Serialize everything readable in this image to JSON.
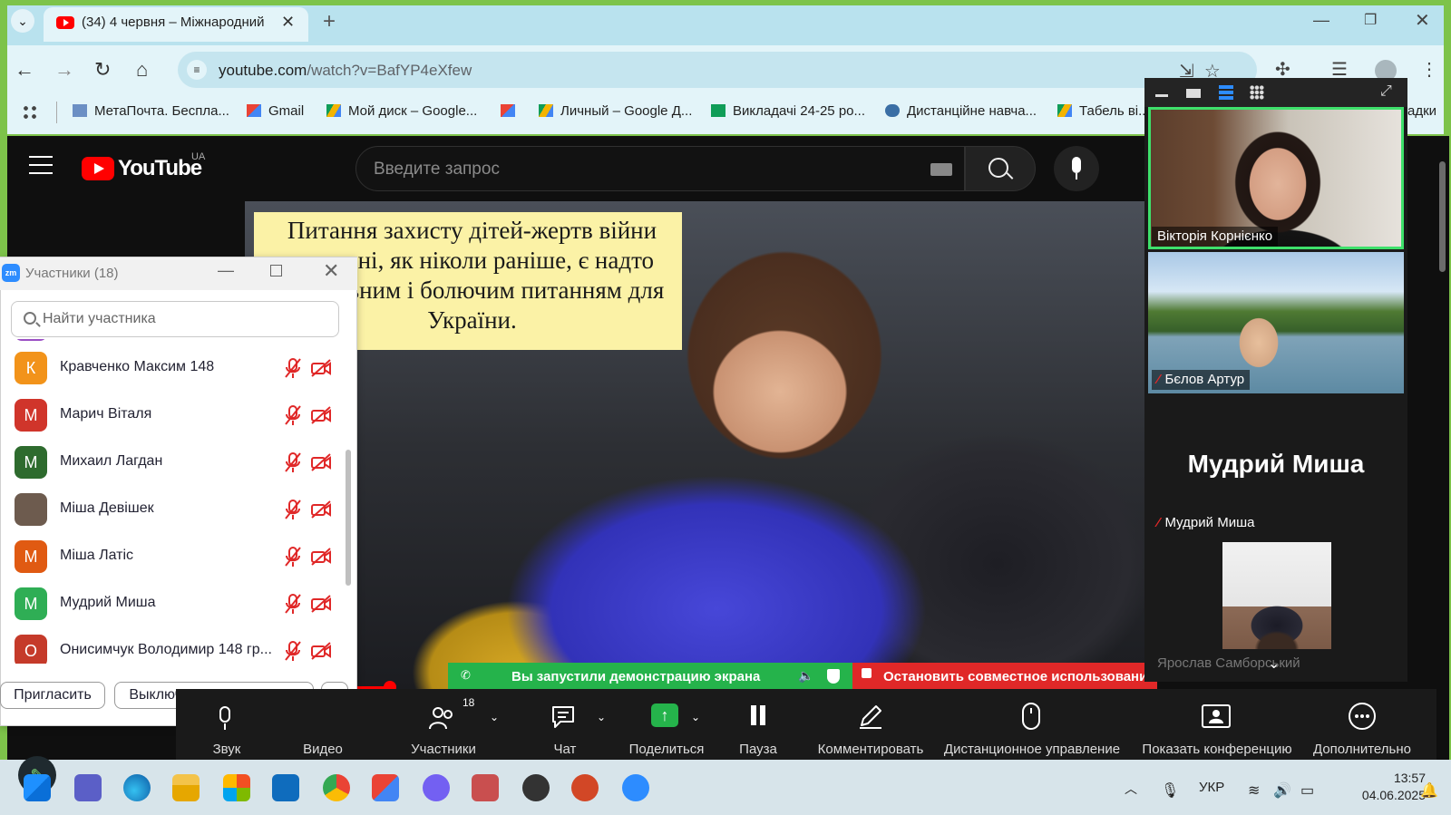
{
  "browser": {
    "tab_title": "(34) 4 червня – Міжнародний",
    "url_host": "youtube.com",
    "url_path": "/watch?v=BafYP4eXfew",
    "bookmarks": [
      {
        "label": "МетаПочта. Беспла..."
      },
      {
        "label": "Gmail"
      },
      {
        "label": "Мой диск – Google..."
      },
      {
        "label": ""
      },
      {
        "label": "Личный – Google Д..."
      },
      {
        "label": "Викладачі 24-25 ро..."
      },
      {
        "label": "Дистанційне навча..."
      },
      {
        "label": "Табель ві..."
      },
      {
        "label": "адки"
      }
    ]
  },
  "youtube": {
    "logo_text": "YouTube",
    "region": "UA",
    "search_placeholder": "Введите запрос",
    "caption": "Питання захисту дітей-жертв війни сьогодні, як ніколи раніше, є надто актуальним і болючим питанням для України.",
    "progress_fraction": 0.16
  },
  "zoom_participants": {
    "title": "Участники (18)",
    "search_placeholder": "Найти участника",
    "participants": [
      {
        "initial": "К",
        "name": "Кравченко Максим 148",
        "color": "#f2931a"
      },
      {
        "initial": "М",
        "name": "Марич Віталя",
        "color": "#d0352b"
      },
      {
        "initial": "М",
        "name": "Михаил Лагдан",
        "color": "#2e6b2e"
      },
      {
        "initial": "",
        "name": "Міша Девішек",
        "color": "#6d5b4e"
      },
      {
        "initial": "М",
        "name": "Міша Латіс",
        "color": "#e05a12"
      },
      {
        "initial": "М",
        "name": "Мудрий Миша",
        "color": "#2fae55"
      },
      {
        "initial": "О",
        "name": "Онисимчук Володимир 148 гр...",
        "color": "#c53a2a"
      }
    ],
    "invite_label": "Пригласить",
    "mute_all_label": "Выключить звук для всех",
    "more_label": "···"
  },
  "zoom_share": {
    "sharing_text": "Вы запустили демонстрацию экрана",
    "stop_text": "Остановить совместное использование"
  },
  "zoom_toolbar": {
    "participants_count": "18",
    "items": [
      {
        "label": "Звук"
      },
      {
        "label": "Видео"
      },
      {
        "label": "Участники"
      },
      {
        "label": "Чат"
      },
      {
        "label": "Поделиться"
      },
      {
        "label": "Пауза"
      },
      {
        "label": "Комментировать"
      },
      {
        "label": "Дистанционное управление"
      },
      {
        "label": "Показать конференцию"
      },
      {
        "label": "Дополнительно"
      }
    ]
  },
  "zoom_gallery": {
    "tiles": [
      {
        "name": "Вікторія Корнієнко"
      },
      {
        "name": "Бєлов Артур"
      },
      {
        "name": "Мудрий Миша",
        "big_name": "Мудрий Миша"
      },
      {
        "name": "Ярослав Самборський"
      }
    ],
    "active_color": "#3ee06b"
  },
  "taskbar": {
    "lang": "УКР",
    "time": "13:57",
    "date": "04.06.2025"
  },
  "colors": {
    "desktop_bg": "#7dc34a",
    "zoom_green": "#25b34b",
    "zoom_red": "#e02828",
    "youtube_red": "#ff0000"
  }
}
